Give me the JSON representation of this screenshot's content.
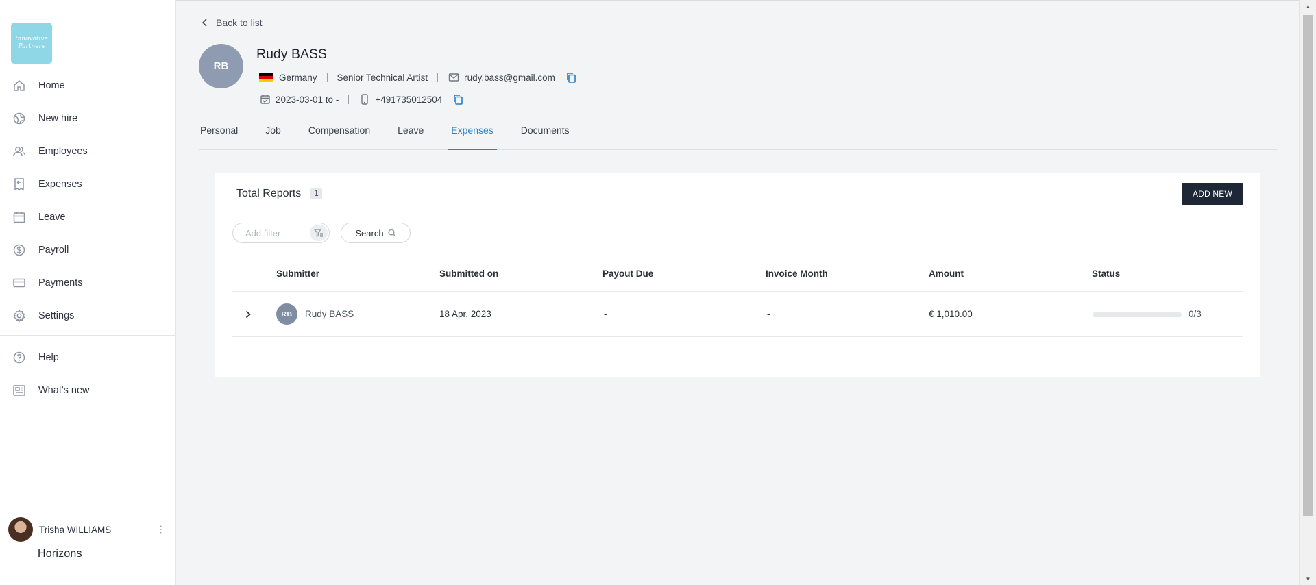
{
  "company": {
    "logo_line1": "Innovative",
    "logo_line2": "Partners"
  },
  "sidebar": {
    "items": [
      {
        "label": "Home",
        "icon": "home-icon"
      },
      {
        "label": "New hire",
        "icon": "globe-icon"
      },
      {
        "label": "Employees",
        "icon": "users-icon"
      },
      {
        "label": "Expenses",
        "icon": "receipt-icon"
      },
      {
        "label": "Leave",
        "icon": "calendar-icon"
      },
      {
        "label": "Payroll",
        "icon": "dollar-icon"
      },
      {
        "label": "Payments",
        "icon": "card-icon"
      },
      {
        "label": "Settings",
        "icon": "gear-icon"
      }
    ],
    "bottom_items": [
      {
        "label": "Help",
        "icon": "help-icon"
      },
      {
        "label": "What's new",
        "icon": "news-icon"
      }
    ],
    "user_name": "Trisha WILLIAMS",
    "brand": "Horizons"
  },
  "header": {
    "back_label": "Back to list",
    "avatar_initials": "RB",
    "name": "Rudy BASS",
    "country": "Germany",
    "job_title": "Senior Technical Artist",
    "email": "rudy.bass@gmail.com",
    "dates": "2023-03-01 to -",
    "phone": "+491735012504",
    "flag_colors": [
      "#000000",
      "#dd0000",
      "#ffce00"
    ]
  },
  "tabs": [
    {
      "label": "Personal",
      "active": false
    },
    {
      "label": "Job",
      "active": false
    },
    {
      "label": "Compensation",
      "active": false
    },
    {
      "label": "Leave",
      "active": false
    },
    {
      "label": "Expenses",
      "active": true
    },
    {
      "label": "Documents",
      "active": false
    }
  ],
  "reports": {
    "title": "Total Reports",
    "count": "1",
    "add_label": "ADD NEW",
    "filter_placeholder": "Add filter",
    "search_label": "Search",
    "columns": [
      "Submitter",
      "Submitted on",
      "Payout Due",
      "Invoice Month",
      "Amount",
      "Status"
    ],
    "rows": [
      {
        "initials": "RB",
        "submitter": "Rudy BASS",
        "submitted_on": "18 Apr. 2023",
        "payout_due": "-",
        "invoice_month": "-",
        "amount": "€ 1,010.00",
        "status_text": "0/3",
        "status_progress": 0
      }
    ]
  },
  "colors": {
    "accent": "#2a86c9",
    "button_dark": "#1e2736",
    "logo_bg": "#8fd6e6"
  }
}
